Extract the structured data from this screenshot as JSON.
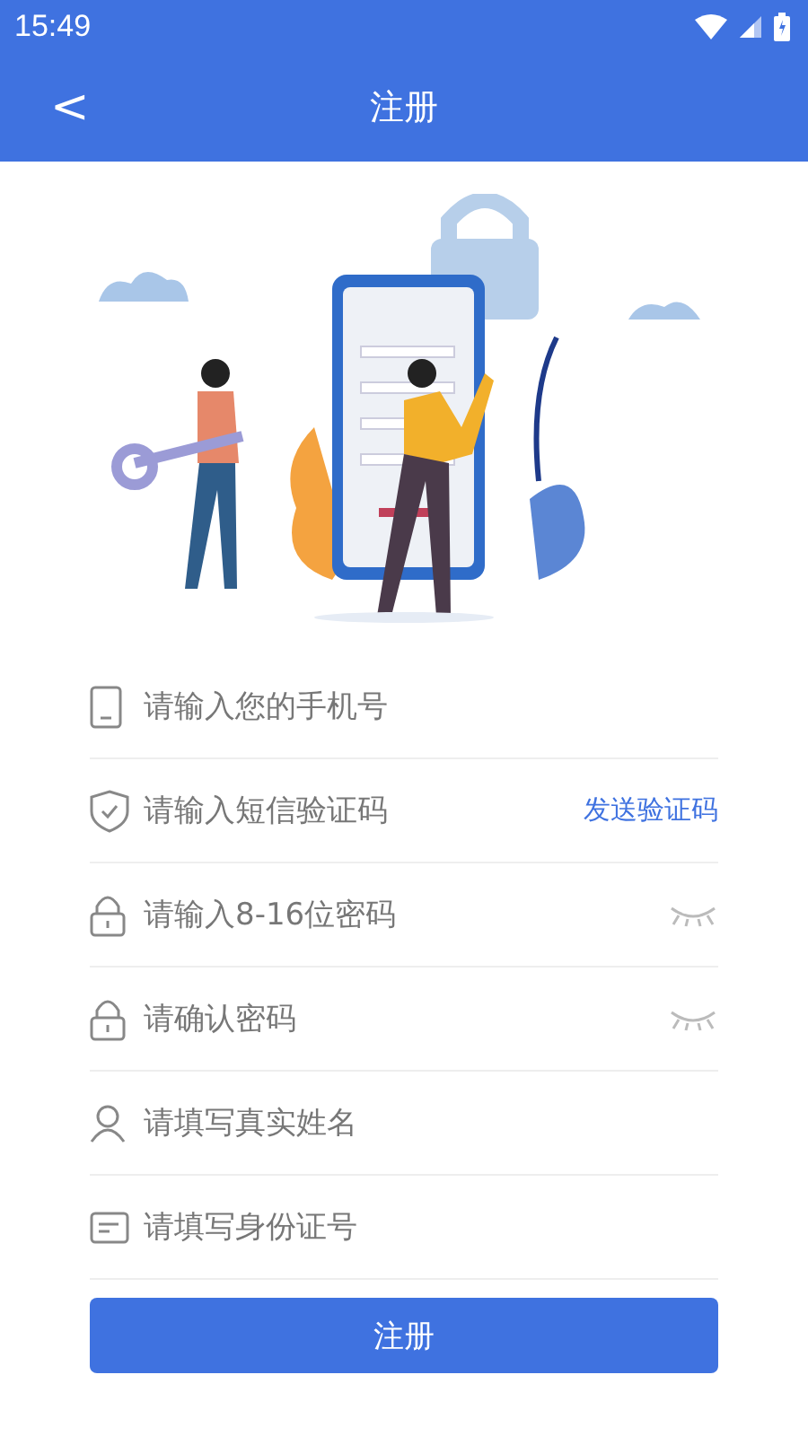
{
  "status_bar": {
    "time": "15:49"
  },
  "header": {
    "back": "<",
    "title": "注册"
  },
  "illustration": {
    "kind": "drawing"
  },
  "fields": [
    {
      "kind": "phone",
      "placeholder": "请输入您的手机号"
    },
    {
      "kind": "shield",
      "placeholder": "请输入短信验证码",
      "action": "发送验证码"
    },
    {
      "kind": "lock",
      "placeholder": "请输入8-16位密码",
      "password_visible": false
    },
    {
      "kind": "lock",
      "placeholder": "请确认密码",
      "password_visible": false
    },
    {
      "kind": "person",
      "placeholder": "请填写真实姓名"
    },
    {
      "kind": "card",
      "placeholder": "请填写身份证号"
    }
  ],
  "submit": {
    "label": "注册"
  }
}
